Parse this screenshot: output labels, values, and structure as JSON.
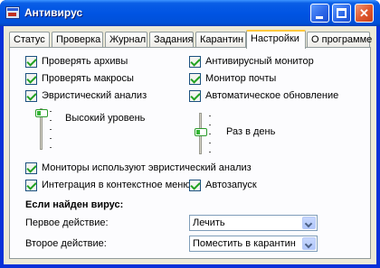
{
  "window": {
    "title": "Антивирус",
    "minimize_label": "",
    "maximize_label": "",
    "close_label": "✕"
  },
  "tabs": [
    {
      "label": "Статус"
    },
    {
      "label": "Проверка"
    },
    {
      "label": "Журнал"
    },
    {
      "label": "Задания"
    },
    {
      "label": "Карантин"
    },
    {
      "label": "Настройки"
    },
    {
      "label": "О программе"
    }
  ],
  "active_tab": "Настройки",
  "settings": {
    "left_checks": [
      {
        "label": "Проверять архивы",
        "checked": true
      },
      {
        "label": "Проверять макросы",
        "checked": true
      },
      {
        "label": "Эвристический анализ",
        "checked": true
      }
    ],
    "right_checks": [
      {
        "label": "Антивирусный монитор",
        "checked": true
      },
      {
        "label": "Монитор почты",
        "checked": true
      },
      {
        "label": "Автоматическое обновление",
        "checked": true
      }
    ],
    "heuristic_level": {
      "label": "Высокий уровень",
      "level": 1.0
    },
    "update_frequency": {
      "label": "Раз в день",
      "level": 0.25
    },
    "bottom_checks": [
      {
        "label": "Мониторы используют эвристический анализ",
        "checked": true
      },
      {
        "label": "Интеграция в контекстное меню",
        "checked": true
      },
      {
        "label": "Автозапуск",
        "checked": true
      }
    ],
    "virus_section": {
      "title": "Если найден вирус:",
      "first_action_label": "Первое действие:",
      "first_action_value": "Лечить",
      "second_action_label": "Второе действие:",
      "second_action_value": "Поместить в карантин"
    }
  },
  "colors": {
    "titlebar": "#0054e3",
    "active_tab_accent": "#ffc83c",
    "checkmark": "#21a121",
    "dialog_bg": "#ece9d8"
  }
}
